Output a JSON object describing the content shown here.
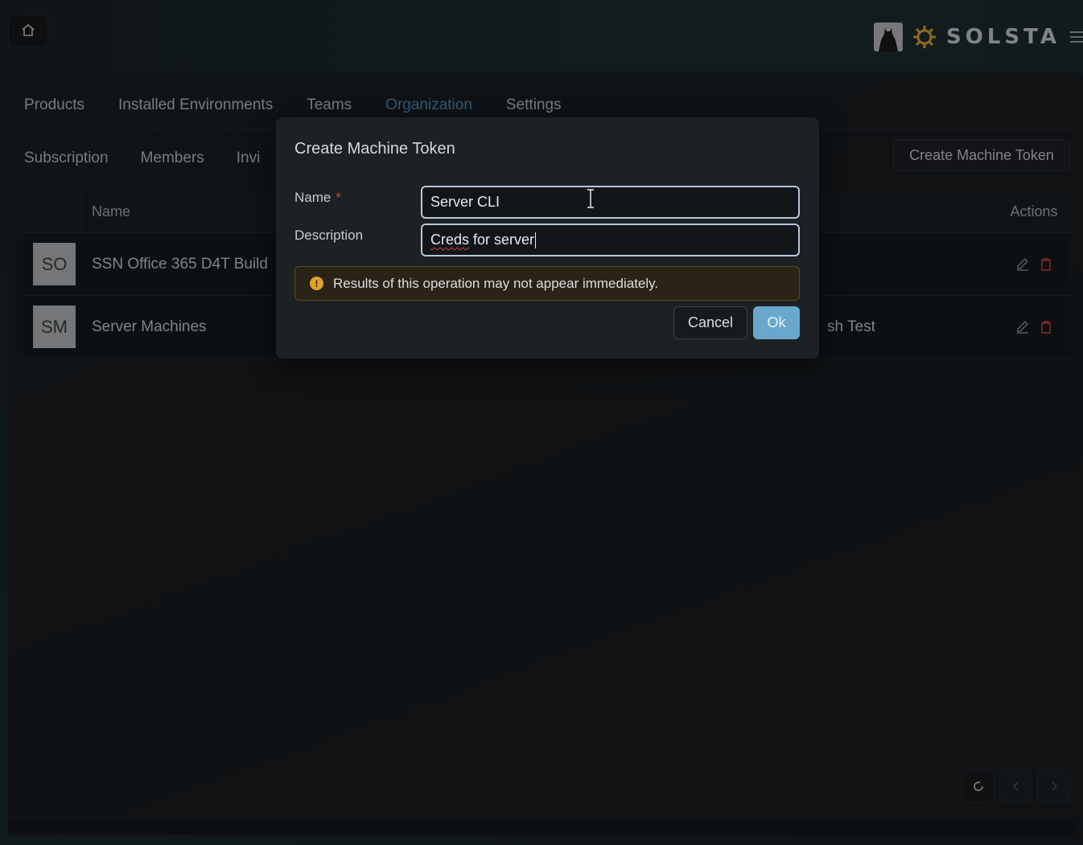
{
  "header": {
    "brand": "SOLSTA",
    "icons": {
      "home": "home-icon",
      "menu": "hamburger-menu-icon",
      "logo": "sun-gear-icon",
      "avatar": "user-avatar"
    }
  },
  "tabs": [
    {
      "label": "Products",
      "active": false
    },
    {
      "label": "Installed Environments",
      "active": false
    },
    {
      "label": "Teams",
      "active": false
    },
    {
      "label": "Organization",
      "active": true
    },
    {
      "label": "Settings",
      "active": false
    }
  ],
  "subtabs": [
    {
      "label": "Subscription"
    },
    {
      "label": "Members"
    },
    {
      "label": "Invi"
    }
  ],
  "create_button": "Create Machine Token",
  "table": {
    "columns": {
      "name": "Name",
      "actions": "Actions"
    },
    "rows": [
      {
        "initials": "SO",
        "name": "SSN Office 365 D4T Build",
        "extra": ""
      },
      {
        "initials": "SM",
        "name": "Server Machines",
        "extra": "sh Test"
      }
    ]
  },
  "modal": {
    "title": "Create Machine Token",
    "name_label": "Name",
    "required_mark": "*",
    "name_value": "Server CLI",
    "description_label": "Description",
    "description_value_misspelled": "Creds",
    "description_value_rest": " for server",
    "alert": "Results of this operation may not appear immediately.",
    "cancel": "Cancel",
    "ok": "Ok"
  },
  "colors": {
    "accent": "#4e89b5",
    "ok_button": "#6aa7cc",
    "warning": "#e0a12a",
    "danger": "#d0443d"
  }
}
